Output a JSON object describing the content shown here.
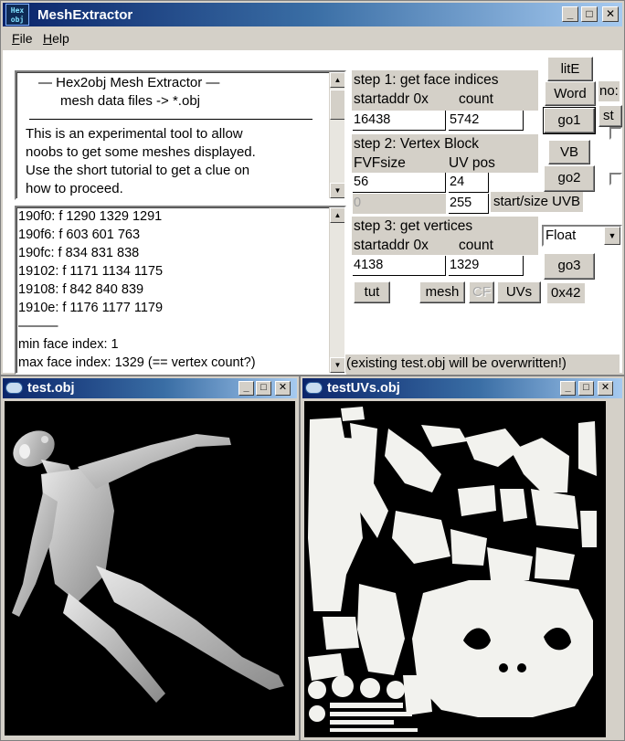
{
  "main_window": {
    "title": "MeshExtractor",
    "icon_text": [
      "Hex",
      "obj"
    ],
    "caption_buttons": [
      "_",
      "□",
      "✕"
    ],
    "menu": [
      {
        "label": "File",
        "accel": "F",
        "rest": "ile"
      },
      {
        "label": "Help",
        "accel": "H",
        "rest": "elp"
      }
    ]
  },
  "info": {
    "line1": "—   Hex2obj Mesh Extractor   —",
    "line2": "mesh data files -> *.obj",
    "para": [
      "This is an experimental tool to allow",
      "noobs to get some meshes displayed.",
      "Use the short tutorial to get a clue on",
      "how to proceed."
    ]
  },
  "log": {
    "lines": [
      "190f0: f  1290 1329 1291",
      "190f6: f  603 601 763",
      "190fc: f  834 831 838",
      "19102: f  1171 1134 1175",
      "19108: f  842 840 839",
      "1910e: f  1176 1177 1179",
      "———",
      "min face index: 1",
      "max face index: 1329 (== vertex count?)"
    ]
  },
  "step1": {
    "title": "step 1: get face indices",
    "label_addr": "startaddr 0x",
    "label_count": "count",
    "addr": "16438",
    "count": "5742"
  },
  "step2": {
    "title": "step 2: Vertex Block",
    "label_fvf": "FVFsize",
    "label_uv": "UV pos",
    "fvf": "56",
    "uvpos": "24",
    "uvb_start": "0",
    "uvb_size": "255",
    "uvb_label": "start/size UVB"
  },
  "step3": {
    "title": "step 3: get vertices",
    "label_addr": "startaddr 0x",
    "label_count": "count",
    "addr": "4138",
    "count": "1329"
  },
  "buttons": {
    "lite": "litE",
    "word": "Word",
    "go1": "go1",
    "vb": "VB",
    "go2": "go2",
    "go3": "go3",
    "tut": "tut",
    "mesh": "mesh",
    "cf": "CF",
    "uvs": "UVs"
  },
  "float_select": "Float",
  "hex_label": "0x42",
  "clipped_labels": [
    "no:",
    "st"
  ],
  "status": "(existing test.obj will be overwritten!)",
  "test_window": {
    "title": "test.obj"
  },
  "uv_window": {
    "title": "testUVs.obj"
  }
}
